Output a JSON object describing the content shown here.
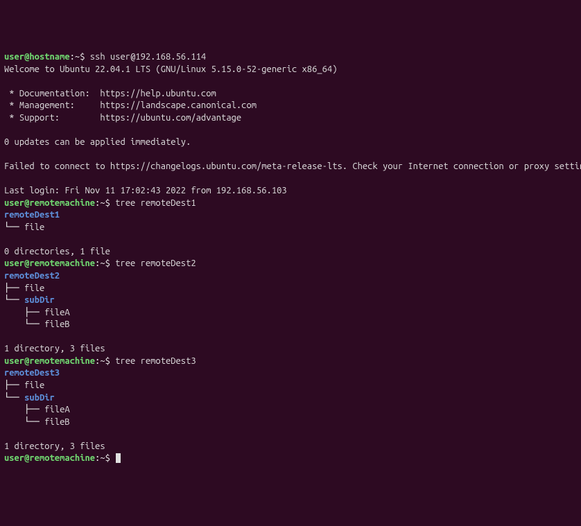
{
  "p1": {
    "user": "user@hostname",
    "sep": ":~",
    "d": "$ ",
    "cmd": "ssh user@192.168.56.114"
  },
  "welcome": "Welcome to Ubuntu 22.04.1 LTS (GNU/Linux 5.15.0-52-generic x86_64)",
  "links": {
    "doc": " * Documentation:  https://help.ubuntu.com",
    "mgmt": " * Management:     https://landscape.canonical.com",
    "sup": " * Support:        https://ubuntu.com/advantage"
  },
  "updates": "0 updates can be applied immediately.",
  "failed": "Failed to connect to https://changelogs.ubuntu.com/meta-release-lts. Check your Internet connection or proxy settings",
  "lastlogin": "Last login: Fri Nov 11 17:02:43 2022 from 192.168.56.103",
  "p2": {
    "user": "user@remotemachine",
    "sep": ":~",
    "d": "$ "
  },
  "cmd_tree1": "tree remoteDest1",
  "cmd_tree2": "tree remoteDest2",
  "cmd_tree3": "tree remoteDest3",
  "tree1": {
    "root": "remoteDest1",
    "l1": "└── file",
    "summary": "0 directories, 1 file"
  },
  "tree2": {
    "root": "remoteDest2",
    "l1": "├── file",
    "l2a": "└── ",
    "l2b": "subDir",
    "l3": "    ├── fileA",
    "l4": "    └── fileB",
    "summary": "1 directory, 3 files"
  },
  "tree3": {
    "root": "remoteDest3",
    "l1": "├── file",
    "l2a": "└── ",
    "l2b": "subDir",
    "l3": "    ├── fileA",
    "l4": "    └── fileB",
    "summary": "1 directory, 3 files"
  }
}
